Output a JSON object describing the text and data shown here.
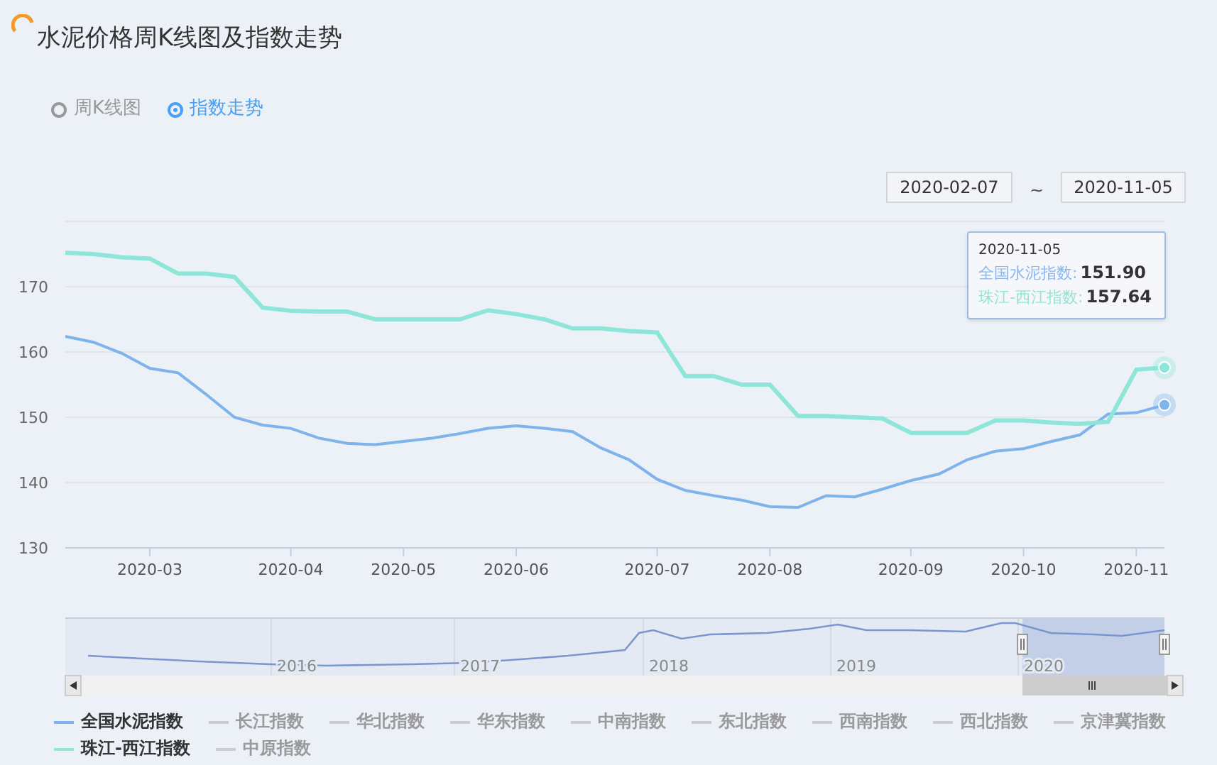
{
  "title": "水泥价格周K线图及指数走势",
  "view_options": [
    {
      "label": "周K线图",
      "selected": false
    },
    {
      "label": "指数走势",
      "selected": true
    }
  ],
  "date_range": {
    "from": "2020-02-07",
    "separator": "~",
    "to": "2020-11-05"
  },
  "chart": {
    "chart_data": {
      "type": "line",
      "grid": true,
      "ylim": [
        130,
        180
      ],
      "categories": [
        null,
        null,
        null,
        "2020-03",
        null,
        null,
        null,
        null,
        "2020-04",
        null,
        null,
        null,
        "2020-05",
        null,
        null,
        null,
        "2020-06",
        null,
        null,
        null,
        null,
        "2020-07",
        null,
        null,
        null,
        "2020-08",
        null,
        null,
        null,
        null,
        "2020-09",
        null,
        null,
        null,
        "2020-10",
        null,
        null,
        null,
        "2020-11",
        null
      ],
      "yticks": [
        130,
        140,
        150,
        160,
        170
      ],
      "series": [
        {
          "name": "全国水泥指数",
          "color": "#7eb3ec",
          "values": [
            162.4,
            161.5,
            159.8,
            157.5,
            156.8,
            153.5,
            150,
            148.8,
            148.3,
            146.8,
            146,
            145.8,
            146.3,
            146.8,
            147.5,
            148.3,
            148.7,
            148.3,
            147.8,
            145.3,
            143.5,
            140.5,
            138.8,
            138,
            137.3,
            136.3,
            136.2,
            138,
            137.8,
            139,
            140.3,
            141.3,
            143.5,
            144.8,
            145.2,
            146.3,
            147.3,
            150.5,
            150.7,
            151.9
          ]
        },
        {
          "name": "珠江-西江指数",
          "color": "#8ee6d8",
          "values": [
            175.2,
            175,
            174.5,
            174.3,
            172,
            172,
            171.5,
            166.8,
            166.3,
            166.2,
            166.2,
            165,
            165,
            165,
            165,
            166.4,
            165.8,
            165,
            163.6,
            163.6,
            163.2,
            163,
            156.3,
            156.3,
            155,
            155,
            150.2,
            150.2,
            150,
            149.8,
            147.6,
            147.6,
            147.6,
            149.5,
            149.5,
            149.2,
            149,
            149.3,
            157.3,
            157.6
          ]
        }
      ]
    },
    "tooltip": {
      "date": "2020-11-05",
      "rows": [
        {
          "label": "全国水泥指数:",
          "value": "151.90",
          "color": "#8ab6f0"
        },
        {
          "label": "珠江-西江指数:",
          "value": "157.64",
          "color": "#95e3d4"
        }
      ]
    }
  },
  "navigator": {
    "years": [
      "2016",
      "2017",
      "2018",
      "2019",
      "2020"
    ]
  },
  "legend": [
    {
      "kind": "series",
      "on": true
    },
    {
      "label": "长江指数",
      "on": false,
      "color": "#cccccc"
    },
    {
      "label": "华北指数",
      "on": false,
      "color": "#cccccc"
    },
    {
      "label": "华东指数",
      "on": false,
      "color": "#cccccc"
    },
    {
      "label": "中南指数",
      "on": false,
      "color": "#cccccc"
    },
    {
      "label": "东北指数",
      "on": false,
      "color": "#cccccc"
    },
    {
      "label": "西南指数",
      "on": false,
      "color": "#cccccc"
    },
    {
      "label": "西北指数",
      "on": false,
      "color": "#cccccc"
    },
    {
      "label": "京津冀指数",
      "on": false,
      "color": "#cccccc"
    },
    {
      "kind": "series",
      "on": true
    },
    {
      "label": "中原指数",
      "on": false,
      "color": "#cccccc"
    }
  ]
}
